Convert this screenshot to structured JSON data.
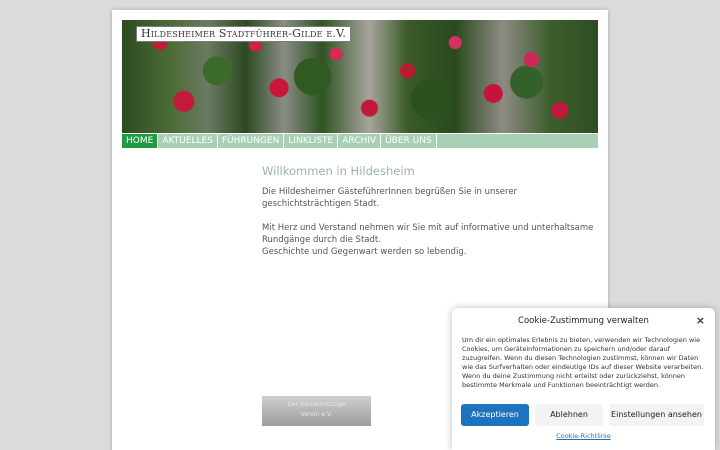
{
  "header": {
    "logo_prefix": "Hildesheimer Stadt",
    "logo_accent": "f",
    "logo_suffix": "ührer-Gilde e.V."
  },
  "nav": {
    "items": [
      {
        "label": "HOME"
      },
      {
        "label": "AKTUELLES"
      },
      {
        "label": "FÜHRUNGEN"
      },
      {
        "label": "LINKLISTE"
      },
      {
        "label": "ARCHIV"
      },
      {
        "label": "ÜBER UNS"
      }
    ]
  },
  "main": {
    "heading": "Willkommen in Hildesheim",
    "paragraph1": "Die Hildesheimer GästeführerInnen begrüßen Sie in unserer geschichtsträchtigen Stadt.",
    "paragraph2_line1": "Mit Herz und Verstand nehmen wir Sie mit auf informative und unterhaltsame Rundgänge durch die Stadt.",
    "paragraph2_line2": "Geschichte und Gegenwart werden so lebendig."
  },
  "badge": {
    "line1": "Der Gemeinnützige",
    "line2": "Verein e.V."
  },
  "cookie": {
    "title": "Cookie-Zustimmung verwalten",
    "close_symbol": "×",
    "text": "Um dir ein optimales Erlebnis zu bieten, verwenden wir Technologien wie Cookies, um Geräteinformationen zu speichern und/oder darauf zuzugreifen. Wenn du diesen Technologien zustimmst, können wir Daten wie das Surfverhalten oder eindeutige IDs auf dieser Website verarbeiten. Wenn du deine Zustimmung nicht erteilst oder zurückziehst, können bestimmte Merkmale und Funktionen beeinträchtigt werden.",
    "accept_label": "Akzeptieren",
    "deny_label": "Ablehnen",
    "settings_label": "Einstellungen ansehen",
    "policy_link": "Cookie-Richtlinie"
  }
}
